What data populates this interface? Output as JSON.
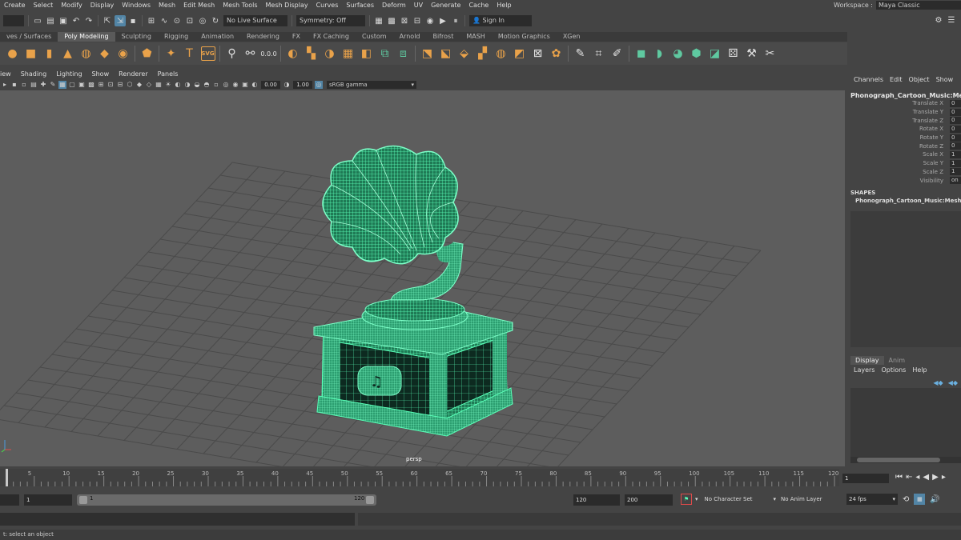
{
  "menubar": {
    "items": [
      "Create",
      "Select",
      "Modify",
      "Display",
      "Windows",
      "Mesh",
      "Edit Mesh",
      "Mesh Tools",
      "Mesh Display",
      "Curves",
      "Surfaces",
      "Deform",
      "UV",
      "Generate",
      "Cache",
      "Help"
    ],
    "workspace_label": "Workspace :",
    "workspace_value": "Maya Classic"
  },
  "statusline": {
    "live_surface": "No Live Surface",
    "symmetry": "Symmetry: Off",
    "sign_in": "Sign In"
  },
  "shelf": {
    "tabs": [
      "ves / Surfaces",
      "Poly Modeling",
      "Sculpting",
      "Rigging",
      "Animation",
      "Rendering",
      "FX",
      "FX Caching",
      "Custom",
      "Arnold",
      "Bifrost",
      "MASH",
      "Motion Graphics",
      "XGen"
    ],
    "active_tab": "Poly Modeling",
    "t_icon_label": "T",
    "svg_icon_label": "SVG"
  },
  "panel": {
    "menu": [
      "iew",
      "Shading",
      "Lighting",
      "Show",
      "Renderer",
      "Panels"
    ],
    "exposure": "0.00",
    "gamma_value": "1.00",
    "color_space": "sRGB gamma",
    "camera": "persp"
  },
  "channelbox": {
    "menu": [
      "Channels",
      "Edit",
      "Object",
      "Show"
    ],
    "object_name": "Phonograph_Cartoon_Music:Mesh",
    "attributes": [
      {
        "name": "Translate X",
        "value": "0"
      },
      {
        "name": "Translate Y",
        "value": "0"
      },
      {
        "name": "Translate Z",
        "value": "0"
      },
      {
        "name": "Rotate X",
        "value": "0"
      },
      {
        "name": "Rotate Y",
        "value": "0"
      },
      {
        "name": "Rotate Z",
        "value": "0"
      },
      {
        "name": "Scale X",
        "value": "1"
      },
      {
        "name": "Scale Y",
        "value": "1"
      },
      {
        "name": "Scale Z",
        "value": "1"
      },
      {
        "name": "Visibility",
        "value": "on"
      }
    ],
    "shapes_label": "SHAPES",
    "shape_name": "Phonograph_Cartoon_Music:MeshS"
  },
  "layers": {
    "tabs": [
      "Display",
      "Anim"
    ],
    "active_tab": "Display",
    "menu": [
      "Layers",
      "Options",
      "Help"
    ]
  },
  "timeline": {
    "ticks": [
      "5",
      "10",
      "15",
      "20",
      "25",
      "30",
      "35",
      "40",
      "45",
      "50",
      "55",
      "60",
      "65",
      "70",
      "75",
      "80",
      "85",
      "90",
      "95",
      "100",
      "105",
      "110",
      "115",
      "120"
    ],
    "current_frame": "1",
    "range_start_outer": "",
    "range_start": "1",
    "range_inner_start": "1",
    "range_inner_end": "120",
    "range_end": "120",
    "range_end_outer": "200",
    "character_set": "No Character Set",
    "anim_layer": "No Anim Layer",
    "fps": "24 fps"
  },
  "helpline": {
    "text": "t: select an object"
  },
  "colors": {
    "mesh_wire": "#5affb8",
    "mesh_dark": "#0d2a20",
    "viewport_bg": "#5d5d5d",
    "selection_blue": "#5285a6",
    "shelf_orange": "#e9a24a"
  }
}
